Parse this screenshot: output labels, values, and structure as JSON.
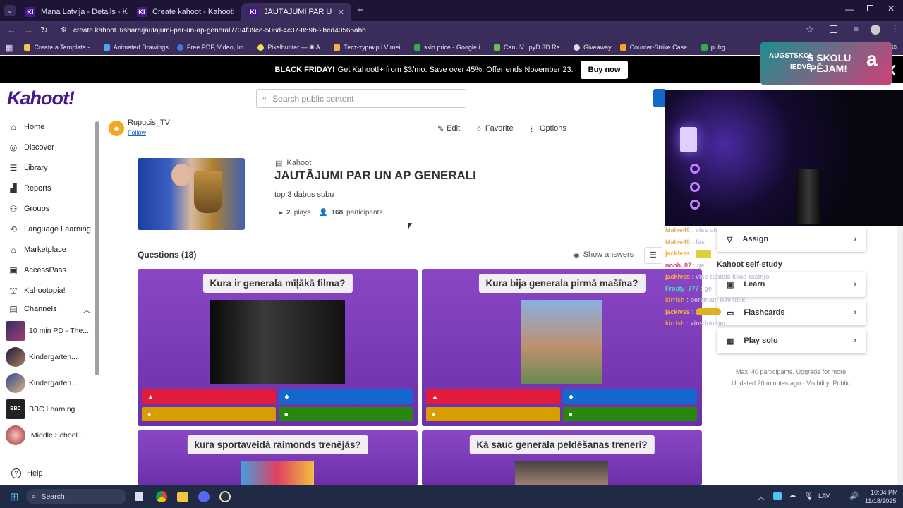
{
  "browser": {
    "tabs": [
      {
        "title": "Mana Latvija - Details - Kahoot!",
        "active": false
      },
      {
        "title": "Create kahoot - Kahoot!",
        "active": false
      },
      {
        "title": "JAUTĀJUMI PAR UN AP GENERA",
        "active": true
      }
    ],
    "url": "create.kahoot.it/share/jautajumi-par-un-ap-generali/734f39ce-506d-4c37-859b-2bed40565abb",
    "bookmarks": [
      "Create a Template -...",
      "Animated Drawings",
      "Free PDF, Video, Im...",
      "Pixelhunter — ✺ A...",
      "Тест-турнир LV mei...",
      "skin price - Google i...",
      "CanUV...pyD 3D Re...",
      "Giveaway",
      "Counter-Strike Case...",
      "pubg"
    ],
    "bookmarks_more": "ks"
  },
  "promo": {
    "bold": "BLACK FRIDAY!",
    "text": "Get Kahoot!+ from $3/mo. Save over 45%. Offer ends November 23.",
    "button": "Buy now"
  },
  "overlay_banner": {
    "line1": "AUGSTSKOL",
    "line2": "IEDVĒ",
    "big1": "S SKOLU",
    "big2": "PĒJAM!",
    "mark": "a"
  },
  "header": {
    "logo": "Kahoot!",
    "search_placeholder": "Search public content"
  },
  "sidebar": {
    "items": [
      {
        "label": "Home",
        "icon": "home-icon"
      },
      {
        "label": "Discover",
        "icon": "compass-icon"
      },
      {
        "label": "Library",
        "icon": "list-icon"
      },
      {
        "label": "Reports",
        "icon": "bar-chart-icon"
      },
      {
        "label": "Groups",
        "icon": "people-icon"
      },
      {
        "label": "Language Learning",
        "icon": "language-icon"
      },
      {
        "label": "Marketplace",
        "icon": "store-icon"
      },
      {
        "label": "AccessPass",
        "icon": "pass-icon"
      },
      {
        "label": "Kahootopia!",
        "icon": "kahootopia-icon"
      }
    ],
    "channels_label": "Channels",
    "channels": [
      "10 min PD - The...",
      "Kindergarten...",
      "Kindergarten...",
      "BBC Learning",
      "!Middle School..."
    ],
    "help": "Help"
  },
  "creator": {
    "name": "Rupucis_TV",
    "follow": "Follow"
  },
  "actions": {
    "edit": "Edit",
    "favorite": "Favorite",
    "options": "Options"
  },
  "kahoot": {
    "type_label": "Kahoot",
    "title": "JAUTĀJUMI PAR UN AP GENERALI",
    "description": "top 3 dabus subu",
    "plays_num": "2",
    "plays_label": "plays",
    "participants_num": "168",
    "participants_label": "participants"
  },
  "questions": {
    "heading": "Questions (18)",
    "show_answers": "Show answers",
    "items": [
      {
        "title": "Kura ir generala mīļākā filma?"
      },
      {
        "title": "Kura bija generala pirmā mašīna?"
      },
      {
        "title": "kura sportaveidā raimonds trenējās?"
      },
      {
        "title": "Kā sauc generala peldēšanas treneri?"
      }
    ]
  },
  "right_panel": {
    "assign": "Assign",
    "self_study": "Kahoot self-study",
    "learn": "Learn",
    "flashcards": "Flashcards",
    "play_solo": "Play solo",
    "max_participants": "Max. 40 participants.",
    "upgrade": "Upgrade for more",
    "updated": "Updated 20 minutes ago · Visibility: Public"
  },
  "chat": [
    {
      "user": "Malxe40",
      "msg": "viss ok",
      "color": "#d6b36a"
    },
    {
      "user": "Malxe40",
      "msg": "fas",
      "color": "#d6b36a"
    },
    {
      "user": "jacklvss",
      "msg": "",
      "color": "#f5b042"
    },
    {
      "user": "noob_07",
      "msg": "ge",
      "color": "#e04080"
    },
    {
      "user": "jacklvss",
      "msg": "viss rūpicis kkad rasinjo",
      "color": "#f5b042"
    },
    {
      "user": "Frosty_777",
      "msg": "ge",
      "color": "#40e0c0"
    },
    {
      "user": "kirrish",
      "msg": "berzinam nav ticik",
      "color": "#e0a050"
    },
    {
      "user": "jacklvss",
      "msg": "",
      "color": "#f5b042"
    },
    {
      "user": "kirrish",
      "msg": "vins loomer",
      "color": "#e0a050"
    }
  ],
  "taskbar": {
    "search": "Search",
    "lang": "LAV",
    "time": "10:04 PM",
    "date": "11/18/2025"
  }
}
